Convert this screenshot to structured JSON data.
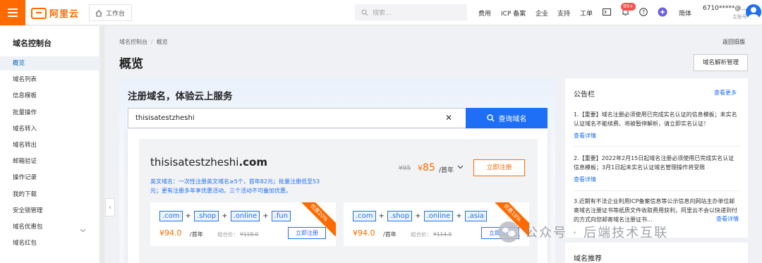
{
  "topbar": {
    "logo_text": "阿里云",
    "workbench_label": "工作台",
    "search_placeholder": "搜索...",
    "nav": [
      "费用",
      "ICP 备案",
      "企业",
      "支持",
      "工单"
    ],
    "notification_badge": "99+",
    "language": "简体",
    "account_name": "6710*****@...",
    "account_role": "主账号"
  },
  "sidebar": {
    "title": "域名控制台",
    "items": [
      {
        "label": "概览",
        "active": true
      },
      {
        "label": "域名列表"
      },
      {
        "label": "信息模板"
      },
      {
        "label": "批量操作"
      },
      {
        "label": "域名转入"
      },
      {
        "label": "域名转出"
      },
      {
        "label": "邮箱验证"
      },
      {
        "label": "操作记录"
      },
      {
        "label": "我的下载"
      },
      {
        "label": "安全锁管理"
      },
      {
        "label": "域名优惠包",
        "has_chevron": true
      },
      {
        "label": "域名红包"
      }
    ]
  },
  "main": {
    "breadcrumb": [
      "域名控制台",
      "概览"
    ],
    "back_old": "返回旧版",
    "page_title": "概览",
    "dns_button": "域名解析管理",
    "register": {
      "title": "注册域名，体验云上服务",
      "input_value": "thisisatestzheshi",
      "query_button": "查询域名"
    },
    "result": {
      "domain_prefix": "thisisatestzheshi",
      "domain_suffix": ".com",
      "old_price": "¥95",
      "price_symbol": "¥",
      "price": "85",
      "unit": "/首年",
      "register_button": "立即注册",
      "promo_line1": "英文域名：一次性注册英文域名≥5个，首年82元；批量注册低至53",
      "promo_line2": "元；更有注册多年享优惠活动。三个活动不可叠加优惠。",
      "bundles": [
        {
          "tlds": [
            ".com",
            ".shop",
            ".online",
            ".fun"
          ],
          "price": "¥94.0",
          "unit": "/首年",
          "combo_label": "组合价：",
          "combo_old": "¥118.0",
          "button": "立即注册",
          "ribbon": "优惠20%"
        },
        {
          "tlds": [
            ".com",
            ".shop",
            ".online",
            ".asia"
          ],
          "price": "¥94.0",
          "unit": "/首年",
          "combo_label": "组合价：",
          "combo_old": "¥114.0",
          "button": "立即注册",
          "ribbon": "优惠18%"
        }
      ]
    }
  },
  "notice": {
    "title": "公告栏",
    "more": "查看更多",
    "items": [
      {
        "text": "1.【重要】域名注册必须使用已完成实名认证的信息模板；未实名认证域名不能续费、将被暂停解析，请立即实名认证！",
        "link": "查看详情"
      },
      {
        "text": "2.【重要】2022年2月15日起域名注册必须使用已完成实名认证信息模板；3月1日起未实名认证域名管理操作将受限",
        "link": "查看详情"
      },
      {
        "text": "3.近期有不法企业利用ICP备案信息等公示信息向网站主办单位邮寄域名注册证书等纸质文件收取费用获利，阿里云不会以快递到付的方式向您邮寄域名注册证书...",
        "link": "查看详情"
      }
    ]
  },
  "recommend_title": "域名推荐",
  "watermark": "公众号 · 后端技术互联"
}
